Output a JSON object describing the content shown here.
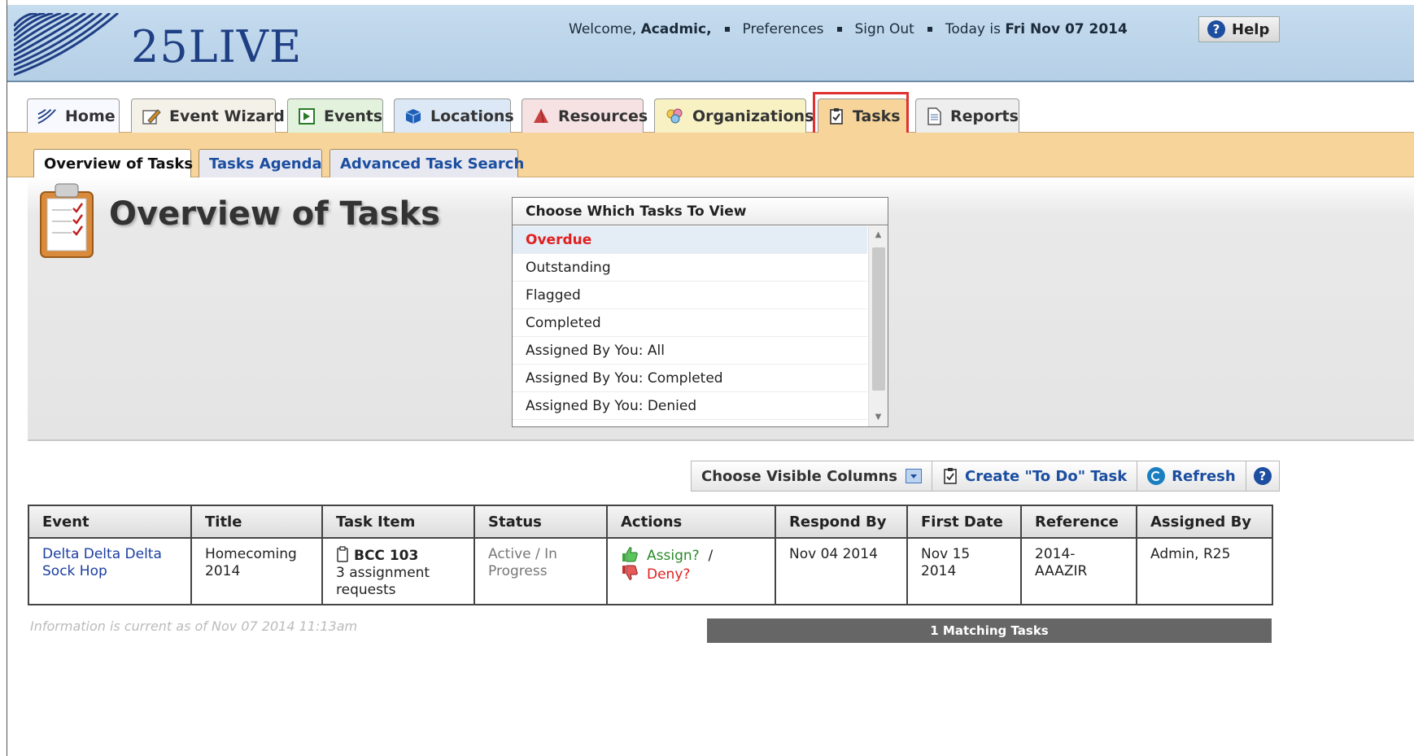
{
  "header": {
    "logo_text": "25LIVE",
    "welcome_prefix": "Welcome,",
    "user_name": "Acadmic,",
    "preferences": "Preferences",
    "sign_out": "Sign Out",
    "today_prefix": "Today is",
    "today_date": "Fri Nov 07 2014",
    "help": "Help"
  },
  "main_tabs": [
    {
      "label": "Home",
      "color": "#f8f8ff"
    },
    {
      "label": "Event Wizard",
      "color": "#f4f1e8"
    },
    {
      "label": "Events",
      "color": "#e2f2dc"
    },
    {
      "label": "Locations",
      "color": "#dce8f5"
    },
    {
      "label": "Resources",
      "color": "#f6e2e2"
    },
    {
      "label": "Organizations",
      "color": "#f7f1c4"
    },
    {
      "label": "Tasks",
      "color": "#f6d49a"
    },
    {
      "label": "Reports",
      "color": "#eeeeee"
    }
  ],
  "sub_tabs": [
    {
      "label": "Overview of Tasks"
    },
    {
      "label": "Tasks Agenda"
    },
    {
      "label": "Advanced Task Search"
    }
  ],
  "panel": {
    "title": "Overview of Tasks",
    "chooser_title": "Choose Which Tasks To View",
    "chooser_items": [
      "Overdue",
      "Outstanding",
      "Flagged",
      "Completed",
      "Assigned By You: All",
      "Assigned By You: Completed",
      "Assigned By You: Denied"
    ]
  },
  "toolbar": {
    "choose_columns": "Choose Visible Columns",
    "create_todo": "Create \"To Do\" Task",
    "refresh": "Refresh"
  },
  "table": {
    "headers": [
      "Event",
      "Title",
      "Task Item",
      "Status",
      "Actions",
      "Respond By",
      "First Date",
      "Reference",
      "Assigned By"
    ],
    "row": {
      "event": "Delta Delta Delta Sock Hop",
      "title": "Homecoming 2014",
      "task_name": "BCC 103",
      "task_detail": "3 assignment requests",
      "status": "Active / In Progress",
      "assign": "Assign?",
      "separator": "/",
      "deny": "Deny?",
      "respond_by": "Nov 04 2014",
      "first_date": "Nov 15 2014",
      "reference": "2014-AAAZIR",
      "assigned_by": "Admin, R25"
    }
  },
  "footer": {
    "note": "Information is current as of Nov 07 2014 11:13am",
    "matching": "1 Matching Tasks"
  }
}
